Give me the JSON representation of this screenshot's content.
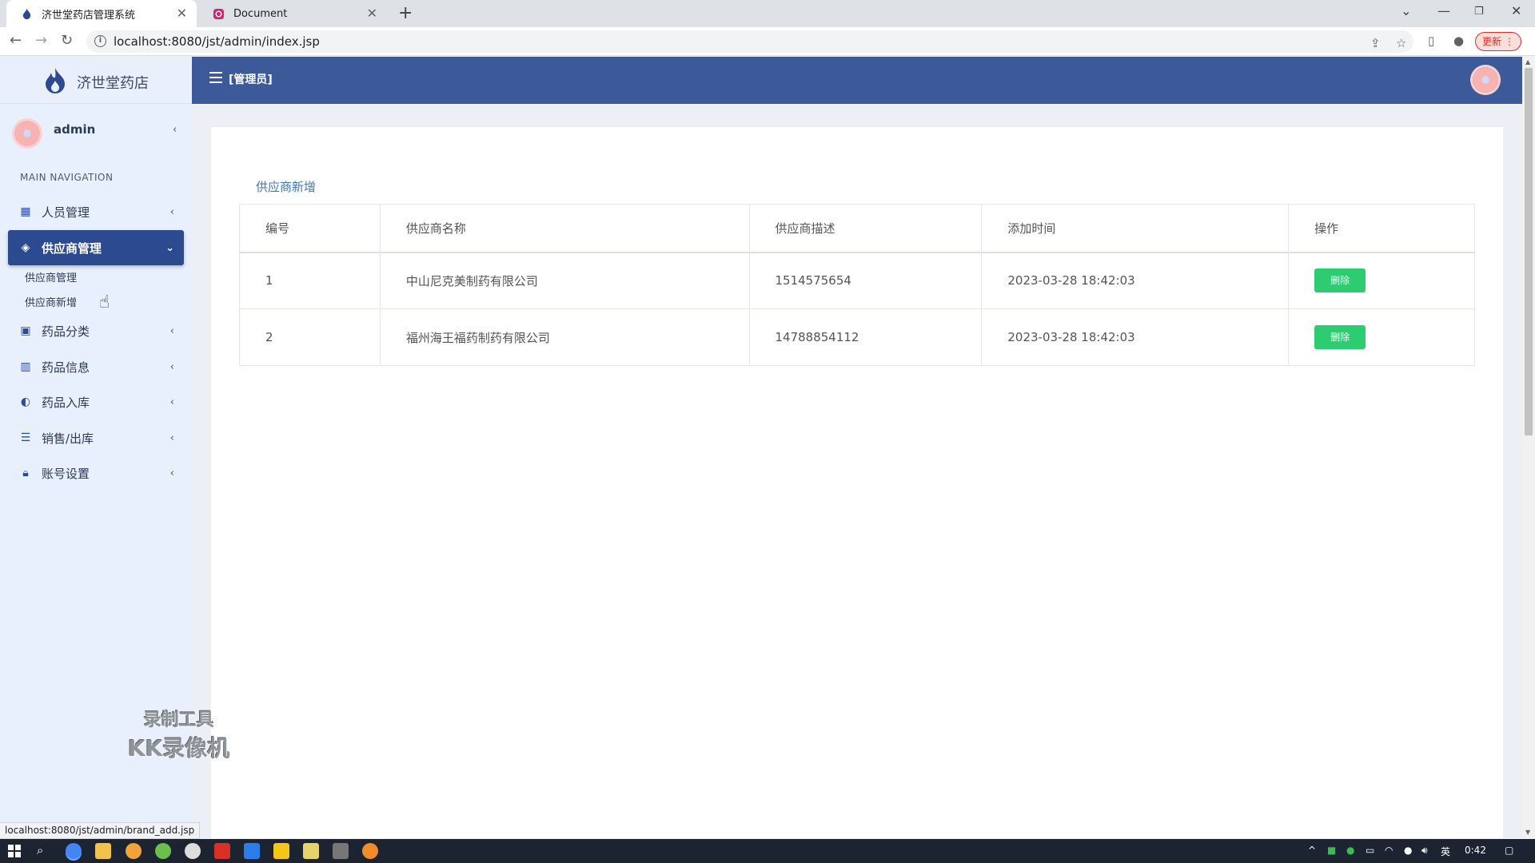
{
  "browser": {
    "tabs": [
      {
        "title": "济世堂药店管理系统",
        "active": true
      },
      {
        "title": "Document",
        "active": false
      }
    ],
    "url": "localhost:8080/jst/admin/index.jsp",
    "update_label": "更新",
    "status_url": "localhost:8080/jst/admin/brand_add.jsp"
  },
  "app": {
    "brand": "济世堂药店",
    "user": {
      "name": "admin"
    },
    "role": "[管理员]",
    "nav_header": "MAIN NAVIGATION",
    "menu": [
      {
        "label": "人员管理",
        "icon": "dashboard-icon"
      },
      {
        "label": "供应商管理",
        "icon": "layers-icon",
        "active": true,
        "children": [
          {
            "label": "供应商管理"
          },
          {
            "label": "供应商新增"
          }
        ]
      },
      {
        "label": "药品分类",
        "icon": "briefcase-icon"
      },
      {
        "label": "药品信息",
        "icon": "bar-chart-icon"
      },
      {
        "label": "药品入库",
        "icon": "adjust-icon"
      },
      {
        "label": "销售/出库",
        "icon": "list-icon"
      },
      {
        "label": "账号设置",
        "icon": "lock-icon"
      }
    ]
  },
  "content": {
    "box_title": "供应商新增",
    "columns": [
      "编号",
      "供应商名称",
      "供应商描述",
      "添加时间",
      "操作"
    ],
    "rows": [
      {
        "id": "1",
        "name": "中山尼克美制药有限公司",
        "desc": "1514575654",
        "time": "2023-03-28 18:42:03",
        "action": "删除"
      },
      {
        "id": "2",
        "name": "福州海王福药制药有限公司",
        "desc": "14788854112",
        "time": "2023-03-28 18:42:03",
        "action": "删除"
      }
    ]
  },
  "watermark": {
    "line1": "录制工具",
    "line2": "KK录像机"
  },
  "taskbar": {
    "ime": "英",
    "clock": "0:42"
  },
  "colors": {
    "topbar": "#3c5a9a",
    "active_menu": "#2c4a90",
    "delete_button": "#2ecc71",
    "sidebar": "#e8f0fd"
  }
}
